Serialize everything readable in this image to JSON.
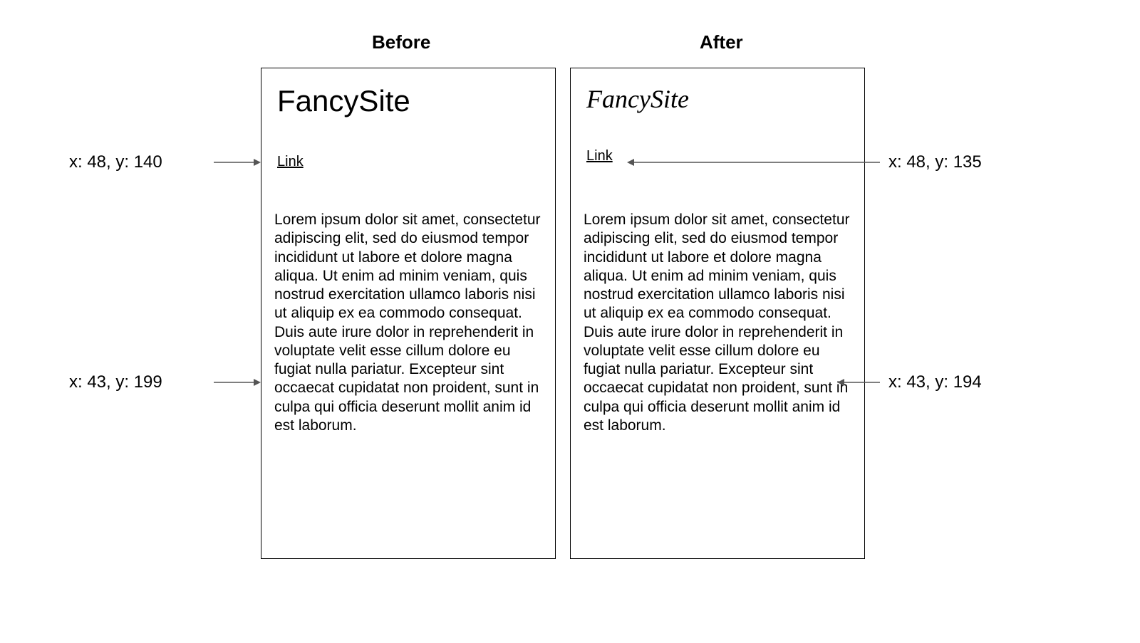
{
  "headings": {
    "before": "Before",
    "after": "After"
  },
  "panels": {
    "before": {
      "title": "FancySite",
      "link_label": "Link",
      "body": "Lorem ipsum dolor sit amet, consectetur adipiscing elit, sed do eiusmod tempor incididunt ut labore et dolore magna aliqua. Ut enim ad minim veniam, quis nostrud exercitation ullamco laboris nisi ut aliquip ex ea commodo consequat. Duis aute irure dolor in reprehenderit in voluptate velit esse cillum dolore eu fugiat nulla pariatur. Excepteur sint occaecat cupidatat non proident, sunt in culpa qui officia deserunt mollit anim id est laborum."
    },
    "after": {
      "title": "FancySite",
      "link_label": "Link",
      "body": "Lorem ipsum dolor sit amet, consectetur adipiscing elit, sed do eiusmod tempor incididunt ut labore et dolore magna aliqua. Ut enim ad minim veniam, quis nostrud exercitation ullamco laboris nisi ut aliquip ex ea commodo consequat. Duis aute irure dolor in reprehenderit in voluptate velit esse cillum dolore eu fugiat nulla pariatur. Excepteur sint occaecat cupidatat non proident, sunt in culpa qui officia deserunt mollit anim id est laborum."
    }
  },
  "annotations": {
    "before_link": "x: 48, y: 140",
    "before_body": "x: 43, y: 199",
    "after_link": "x: 48, y: 135",
    "after_body": "x: 43, y: 194"
  }
}
